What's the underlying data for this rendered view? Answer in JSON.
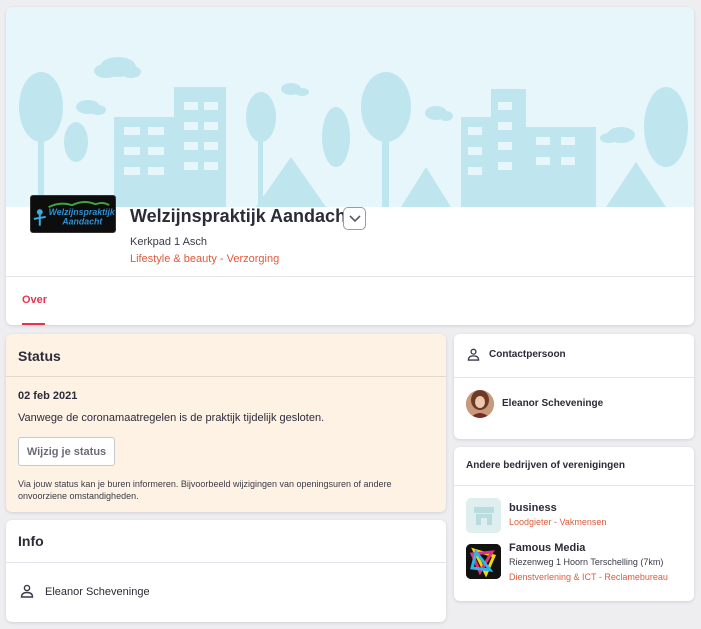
{
  "header": {
    "logo_text": "Welzijnspraktijk Aandacht",
    "company_name": "Welzijnspraktijk Aandacht",
    "address": "Kerkpad 1 Asch",
    "category": "Lifestyle & beauty - Verzorging",
    "tabs": [
      {
        "label": "Over",
        "active": true
      }
    ],
    "icons": {
      "dropdown": "chevron-down-icon"
    },
    "colors": {
      "accent": "#e8334e",
      "category": "#e05a3a",
      "banner": "#e6f6fb"
    }
  },
  "status": {
    "title": "Status",
    "date": "02 feb 2021",
    "text": "Vanwege de coronamaatregelen is de praktijk tijdelijk gesloten.",
    "button_label": "Wijzig je status",
    "hint": "Via jouw status kan je buren informeren. Bijvoorbeeld wijzigingen van openingsuren of andere onvoorziene omstandigheden.",
    "background": "#fef2e4"
  },
  "info": {
    "title": "Info",
    "person_name": "Eleanor Scheveninge",
    "icon": "person-icon"
  },
  "contact": {
    "title": "Contactpersoon",
    "person_name": "Eleanor Scheveninge",
    "icon": "person-icon"
  },
  "others": {
    "title": "Andere bedrijven of verenigingen",
    "items": [
      {
        "name": "business",
        "address": "",
        "category": "Loodgieter - Vakmensen",
        "icon": "store-icon"
      },
      {
        "name": "Famous Media",
        "address": "Riezenweg 1 Hoorn Terschelling (7km)",
        "category": "Dienstverlening & ICT - Reclamebureau"
      }
    ]
  }
}
